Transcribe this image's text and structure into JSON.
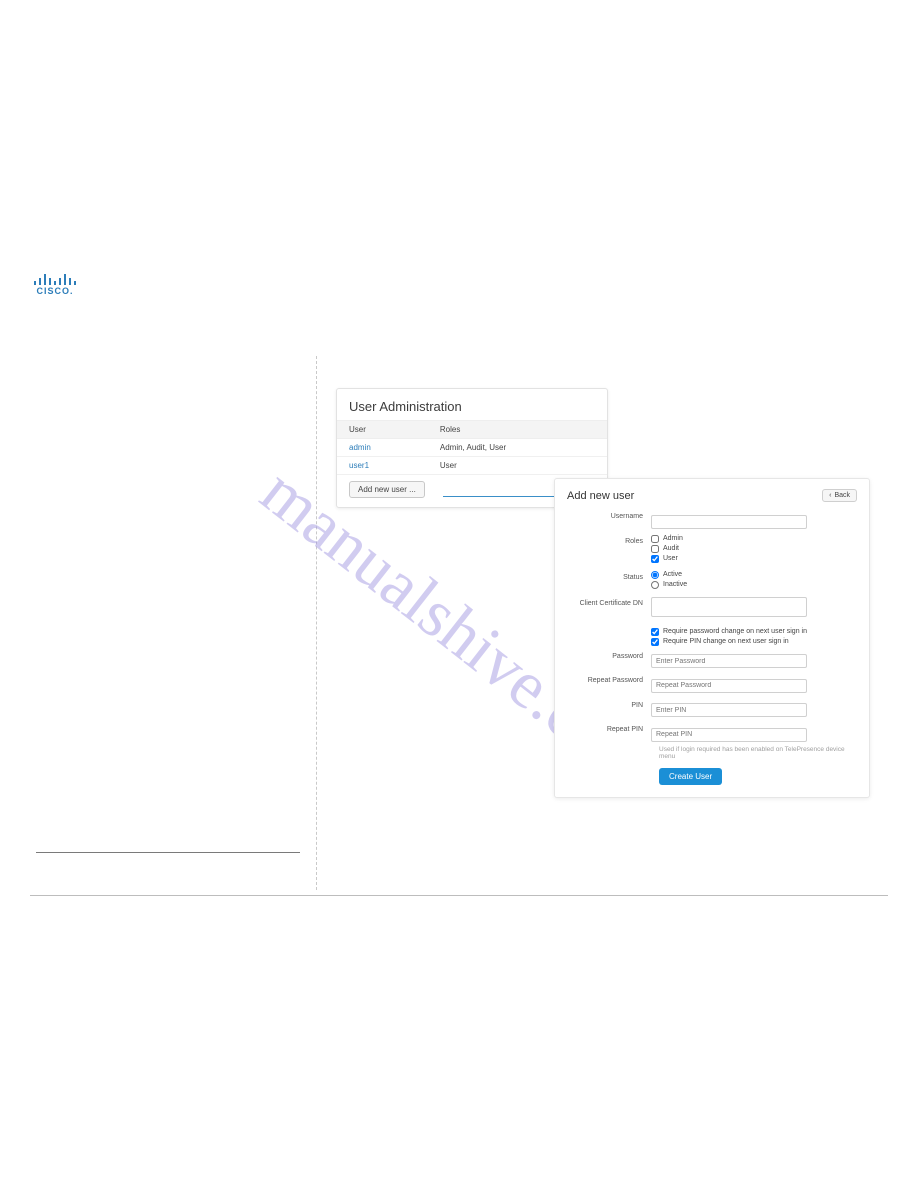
{
  "brand": {
    "name": "CISCO."
  },
  "watermark": "manualshive.com",
  "ua_panel": {
    "title": "User Administration",
    "headers": {
      "user": "User",
      "roles": "Roles"
    },
    "rows": [
      {
        "user": "admin",
        "roles": "Admin, Audit, User"
      },
      {
        "user": "user1",
        "roles": "User"
      }
    ],
    "add_button": "Add new user ..."
  },
  "anu_panel": {
    "title": "Add new user",
    "back_label": "Back",
    "labels": {
      "username": "Username",
      "roles": "Roles",
      "status": "Status",
      "client_cert": "Client Certificate DN",
      "password": "Password",
      "repeat_password": "Repeat Password",
      "pin": "PIN",
      "repeat_pin": "Repeat PIN"
    },
    "roles": {
      "admin": "Admin",
      "audit": "Audit",
      "user": "User"
    },
    "status": {
      "active": "Active",
      "inactive": "Inactive"
    },
    "flags": {
      "require_pw": "Require password change on next user sign in",
      "require_pin": "Require PIN change on next user sign in"
    },
    "placeholders": {
      "password": "Enter Password",
      "repeat_password": "Repeat Password",
      "pin": "Enter PIN",
      "repeat_pin": "Repeat PIN"
    },
    "hint": "Used if login required has been enabled on TelePresence device menu",
    "submit": "Create User"
  }
}
